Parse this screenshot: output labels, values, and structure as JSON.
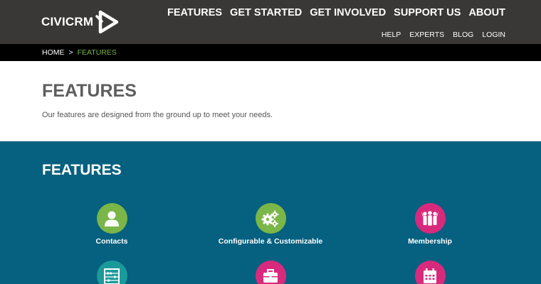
{
  "brand": {
    "logo_text": "CIVICRM"
  },
  "nav": {
    "main": [
      {
        "label": "FEATURES",
        "active": true
      },
      {
        "label": "GET STARTED",
        "active": false
      },
      {
        "label": "GET INVOLVED",
        "active": false
      },
      {
        "label": "SUPPORT US",
        "active": false
      },
      {
        "label": "ABOUT",
        "active": false
      }
    ],
    "secondary": [
      {
        "label": "HELP"
      },
      {
        "label": "EXPERTS"
      },
      {
        "label": "BLOG"
      },
      {
        "label": "LOGIN"
      }
    ]
  },
  "breadcrumb": {
    "home": "HOME",
    "separator": ">",
    "current": "FEATURES"
  },
  "intro": {
    "title": "FEATURES",
    "description": "Our features are designed from the ground up to meet your needs."
  },
  "features": {
    "heading": "FEATURES",
    "items": [
      {
        "label": "Contacts",
        "icon": "person-icon",
        "color": "#7ab648"
      },
      {
        "label": "Configurable & Customizable",
        "icon": "gears-icon",
        "color": "#7ab648"
      },
      {
        "label": "Membership",
        "icon": "group-icon",
        "color": "#d82a7d"
      },
      {
        "label": "",
        "icon": "abacus-icon",
        "color": "#1b9a9a"
      },
      {
        "label": "",
        "icon": "briefcase-icon",
        "color": "#d82a7d"
      },
      {
        "label": "",
        "icon": "calendar-icon",
        "color": "#d82a7d"
      }
    ]
  },
  "colors": {
    "header_bg": "#3a3836",
    "breadcrumb_bg": "#000000",
    "breadcrumb_current": "#7ab648",
    "features_bg": "#06607f"
  }
}
